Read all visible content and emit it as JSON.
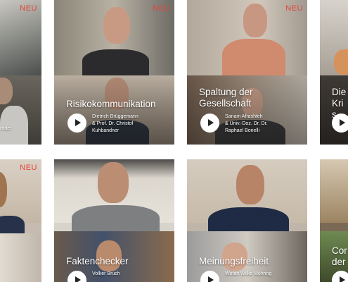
{
  "cards": [
    {
      "badge": "NEU",
      "title": "",
      "authors": [
        "röder"
      ]
    },
    {
      "badge": "NEU",
      "title": "Risikokommunikation",
      "authors": [
        "Dietrich Brüggemann",
        "& Prof. Dr. Christof",
        "Kuhbandner"
      ]
    },
    {
      "badge": "NEU",
      "title": "Spaltung der Gesellschaft",
      "authors": [
        "Sanam Afrashteh",
        "& Univ.-Doz. Dr. Dr.",
        "Raphael Bonelli"
      ]
    },
    {
      "badge": "",
      "title": "Die Kris",
      "authors": []
    },
    {
      "badge": "NEU",
      "title": "",
      "authors": []
    },
    {
      "badge": "",
      "title": "Faktenchecker",
      "authors": [
        "Volker Bruch"
      ]
    },
    {
      "badge": "",
      "title": "Meinungsfreiheit",
      "authors": [
        "Wotan Wilke Möhring"
      ]
    },
    {
      "badge": "",
      "title": "Cor der",
      "authors": []
    }
  ],
  "colors": {
    "badge": "#e4433a",
    "play_button": "#ffffff",
    "text": "#ffffff"
  },
  "icons": [
    "play-icon"
  ]
}
